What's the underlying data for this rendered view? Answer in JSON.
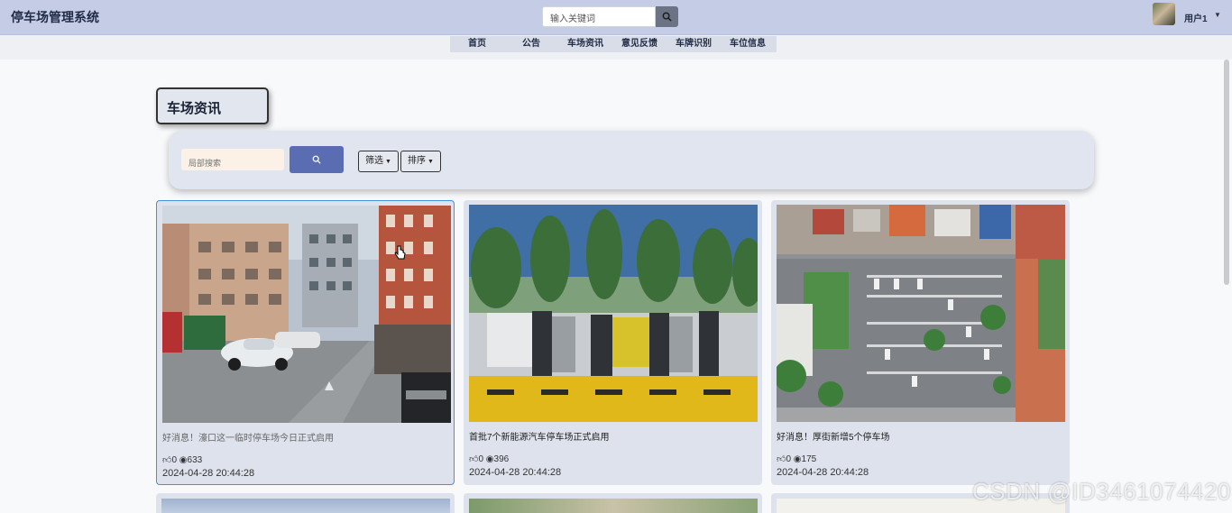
{
  "header": {
    "brand": "停车场管理系统",
    "search_placeholder": "输入关键词",
    "user_label": "用户1"
  },
  "nav": {
    "items": [
      {
        "label": "首页"
      },
      {
        "label": "公告"
      },
      {
        "label": "车场资讯"
      },
      {
        "label": "意见反馈"
      },
      {
        "label": "车牌识别"
      },
      {
        "label": "车位信息"
      }
    ]
  },
  "page": {
    "title": "车场资讯"
  },
  "filters": {
    "local_search_placeholder": "局部搜索",
    "filter_label": "筛选",
    "sort_label": "排序"
  },
  "cards": [
    {
      "title": "好消息！濠口这一临时停车场今日正式启用",
      "likes": "0",
      "views": "633",
      "date": "2024-04-28 20:44:28"
    },
    {
      "title": "首批7个新能源汽车停车场正式启用",
      "likes": "0",
      "views": "396",
      "date": "2024-04-28 20:44:28"
    },
    {
      "title": "好消息！厚街新增5个停车场",
      "likes": "0",
      "views": "175",
      "date": "2024-04-28 20:44:28"
    }
  ],
  "watermark": "CSDN @ID3461074420",
  "colors": {
    "header_bg": "#c5cde6",
    "nav_bg": "#d8dde8",
    "panel_bg": "#e1e5ef",
    "search_button": "#5a6db3",
    "card_bg": "#dde2ec",
    "active_border": "#4a90d6"
  }
}
